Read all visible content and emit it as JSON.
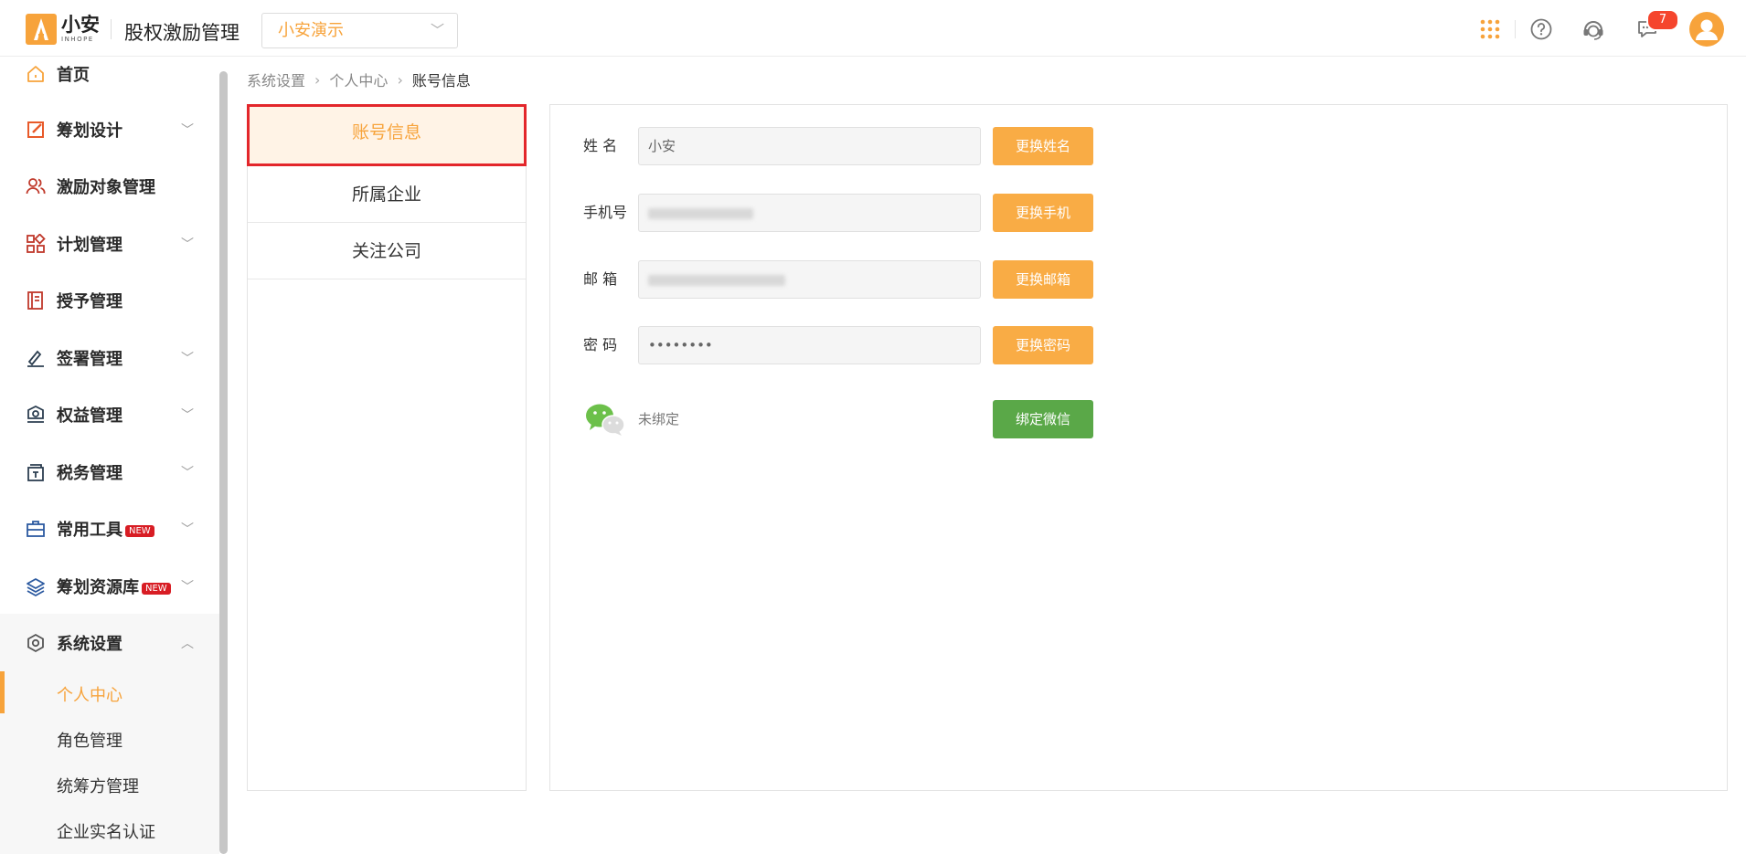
{
  "header": {
    "logo_cn": "小安",
    "logo_en": "INHOPE",
    "app_title": "股权激励管理",
    "company_select": "小安演示",
    "notification_count": "7"
  },
  "colors": {
    "accent": "#f7a33b",
    "button": "#f9ac45",
    "wechat_button": "#5aa848",
    "badge": "#f5452d"
  },
  "sidebar": {
    "items": [
      {
        "label": "首页",
        "icon": "home-icon"
      },
      {
        "label": "筹划设计",
        "icon": "edit-icon"
      },
      {
        "label": "激励对象管理",
        "icon": "users-icon"
      },
      {
        "label": "计划管理",
        "icon": "grid-icon"
      },
      {
        "label": "授予管理",
        "icon": "book-icon"
      },
      {
        "label": "签署管理",
        "icon": "sign-icon"
      },
      {
        "label": "权益管理",
        "icon": "shield-icon"
      },
      {
        "label": "税务管理",
        "icon": "tax-icon"
      },
      {
        "label": "常用工具",
        "icon": "toolbox-icon",
        "badge": "NEW"
      },
      {
        "label": "筹划资源库",
        "icon": "layers-icon",
        "badge": "NEW"
      },
      {
        "label": "系统设置",
        "icon": "settings-icon"
      }
    ],
    "sub_items": [
      {
        "label": "个人中心"
      },
      {
        "label": "角色管理"
      },
      {
        "label": "统筹方管理"
      },
      {
        "label": "企业实名认证"
      }
    ]
  },
  "breadcrumb": [
    "系统设置",
    "个人中心",
    "账号信息"
  ],
  "tabs": [
    "账号信息",
    "所属企业",
    "关注公司"
  ],
  "form": {
    "name": {
      "label": "姓 名",
      "value": "小安",
      "button": "更换姓名"
    },
    "phone": {
      "label": "手机号",
      "button": "更换手机"
    },
    "email": {
      "label": "邮 箱",
      "button": "更换邮箱"
    },
    "password": {
      "label": "密 码",
      "value": "••••••••",
      "button": "更换密码"
    },
    "wechat": {
      "status": "未绑定",
      "button": "绑定微信"
    }
  }
}
